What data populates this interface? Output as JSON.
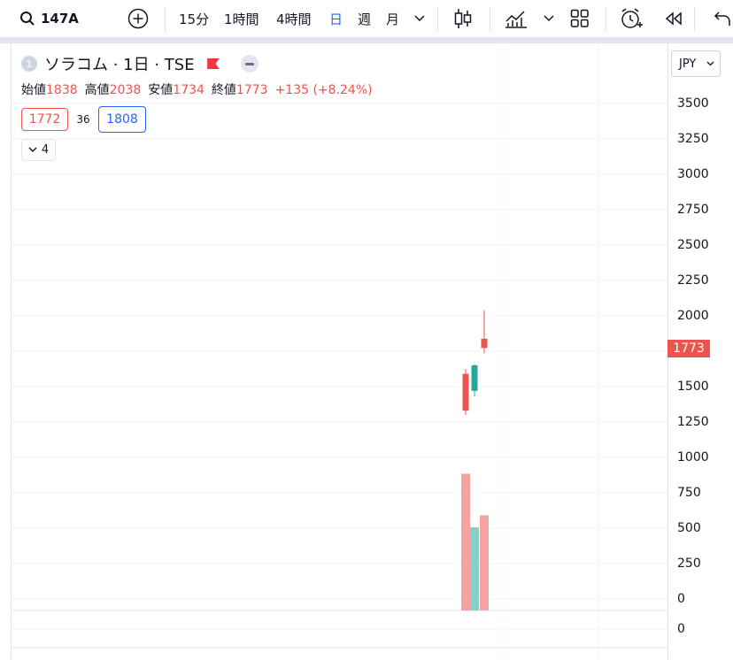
{
  "toolbar": {
    "symbol": "147A",
    "intervals": [
      "15分",
      "1時間",
      "4時間",
      "日",
      "週",
      "月"
    ],
    "active_interval": "日"
  },
  "legend": {
    "badge": "1",
    "title": "ソラコム · 1日 · TSE",
    "open_label": "始値",
    "open": "1838",
    "high_label": "高値",
    "high": "2038",
    "low_label": "安値",
    "low": "1734",
    "close_label": "終値",
    "close": "1773",
    "change": "+135 (+8.24%)",
    "bid": "1772",
    "spread": "36",
    "ask": "1808",
    "indicators_count": "4"
  },
  "price_scale": {
    "currency": "JPY",
    "ticks": [
      "3500",
      "3250",
      "3000",
      "2750",
      "2500",
      "2250",
      "2000",
      "1500",
      "1250",
      "1000",
      "750",
      "500",
      "250",
      "0"
    ],
    "last_price": "1773",
    "lower_pane_tick": "0"
  },
  "colors": {
    "up": "#26a69a",
    "down": "#ef5350",
    "active": "#2962ff",
    "vol_up": "#89cfc6",
    "vol_down": "#f4a3a1"
  },
  "chart_data": {
    "type": "candlestick",
    "candles": [
      {
        "open": 1590,
        "high": 1625,
        "low": 1300,
        "close": 1330
      },
      {
        "open": 1470,
        "high": 1660,
        "low": 1430,
        "close": 1650
      },
      {
        "open": 1838,
        "high": 2038,
        "low": 1734,
        "close": 1773
      }
    ],
    "volume": [
      920,
      560,
      640
    ],
    "price_axis": {
      "min": 0,
      "max": 3500,
      "step": 250
    },
    "volume_axis": {
      "min": 0,
      "max": 1000,
      "step": 250
    }
  }
}
